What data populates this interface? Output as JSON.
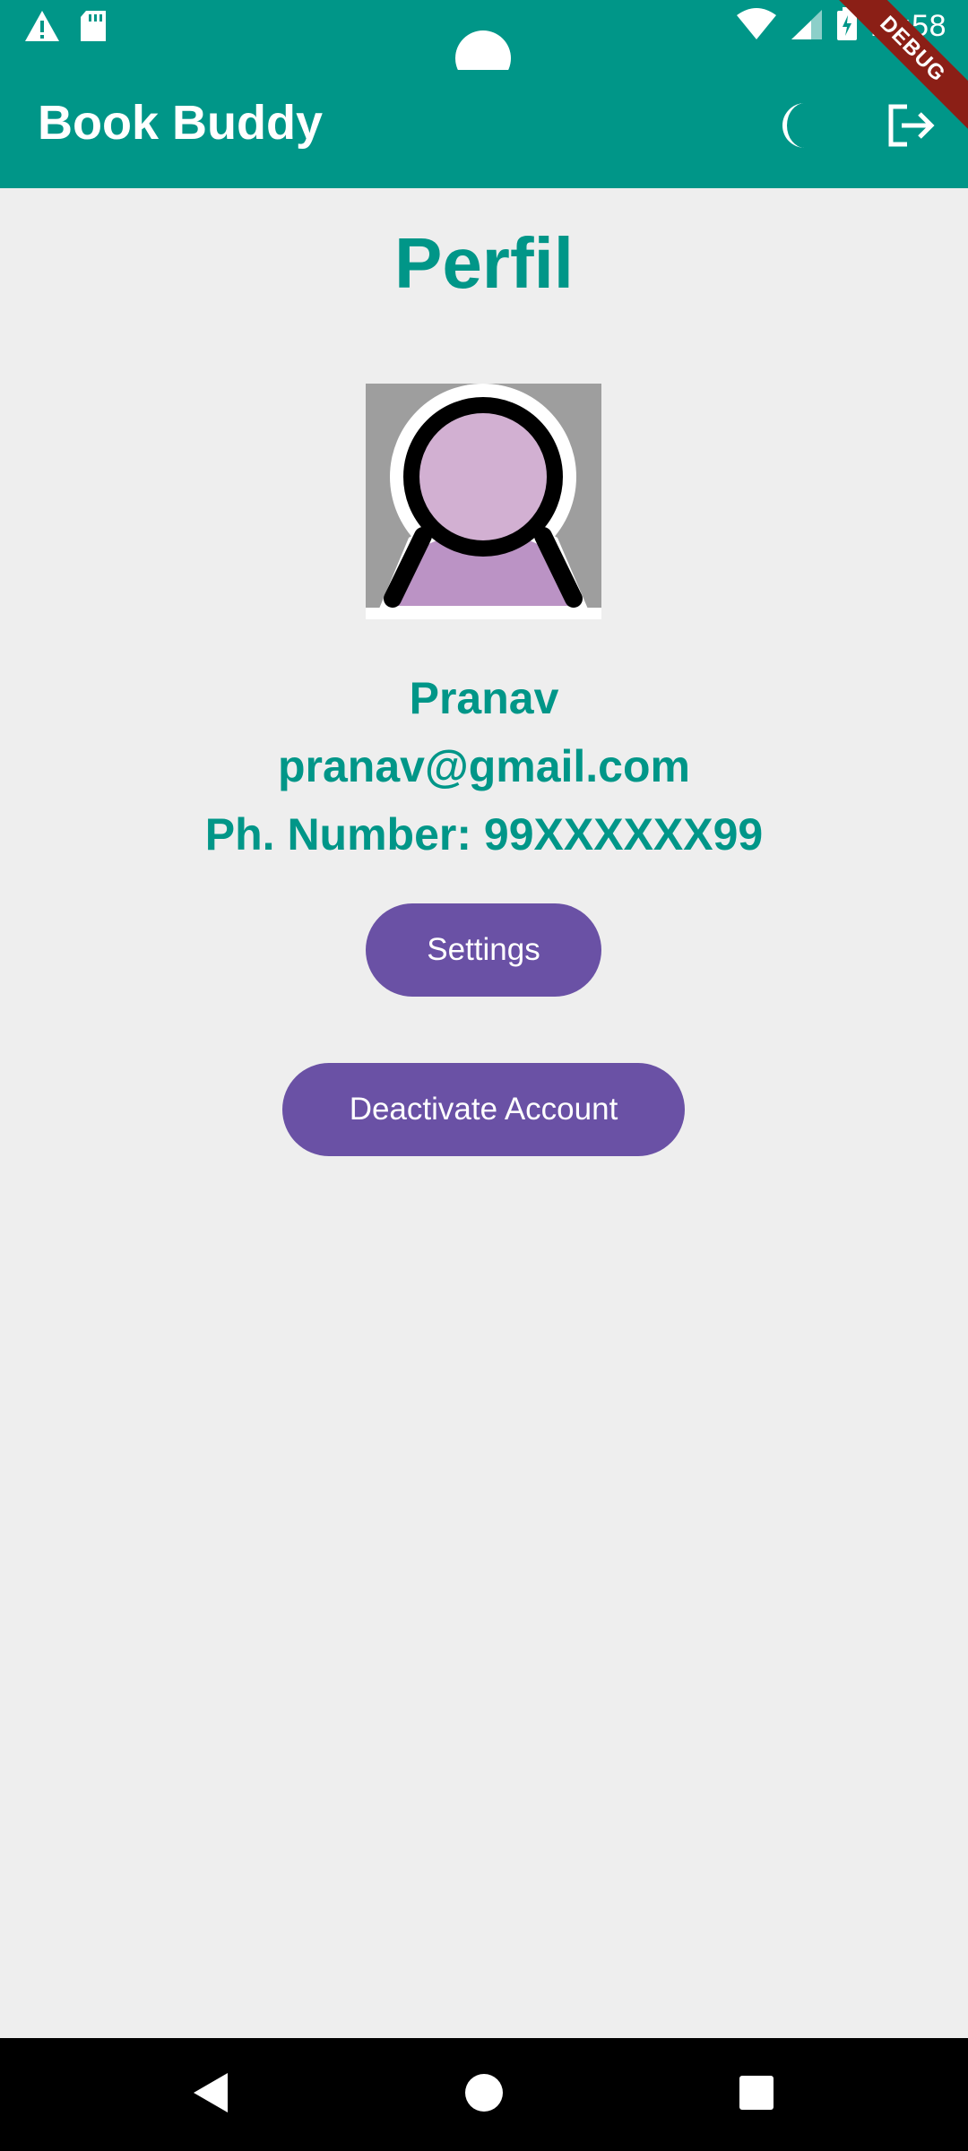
{
  "status_bar": {
    "time": "11:58",
    "left_icons": [
      "warning-icon",
      "sd-card-icon"
    ],
    "right_icons": [
      "wifi-icon",
      "signal-icon",
      "battery-charging-icon"
    ]
  },
  "app_bar": {
    "title": "Book Buddy",
    "actions": [
      "dark-mode-moon-icon",
      "logout-icon"
    ],
    "debug_banner": "DEBUG",
    "color": "#009688"
  },
  "profile": {
    "page_title": "Perfil",
    "avatar_icon": "person-avatar-icon",
    "name": "Pranav",
    "email": "pranav@gmail.com",
    "phone": "Ph. Number: 99XXXXXX99"
  },
  "buttons": {
    "settings_label": "Settings",
    "deactivate_label": "Deactivate Account",
    "color": "#6a51a5"
  },
  "nav_bar": {
    "icons": [
      "back-icon",
      "home-icon",
      "recents-icon"
    ]
  }
}
